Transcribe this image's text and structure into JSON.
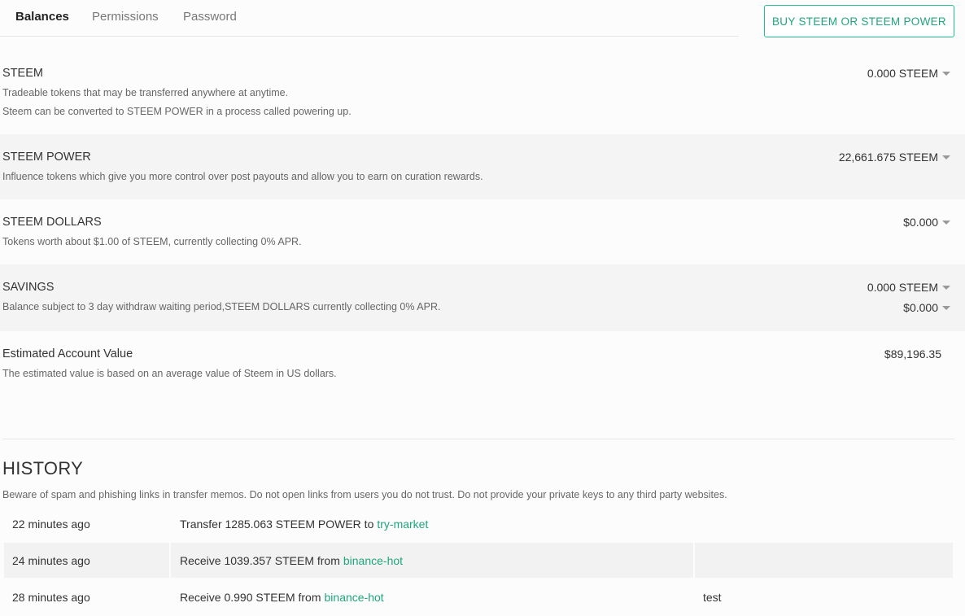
{
  "tabs": [
    {
      "label": "Balances",
      "active": true
    },
    {
      "label": "Permissions",
      "active": false
    },
    {
      "label": "Password",
      "active": false
    }
  ],
  "buy_button": "BUY STEEM OR STEEM POWER",
  "balances": {
    "steem": {
      "title": "STEEM",
      "desc1": "Tradeable tokens that may be transferred anywhere at anytime.",
      "desc2": "Steem can be converted to STEEM POWER in a process called powering up.",
      "amount": "0.000 STEEM"
    },
    "steem_power": {
      "title": "STEEM POWER",
      "desc1": "Influence tokens which give you more control over post payouts and allow you to earn on curation rewards.",
      "amount": "22,661.675 STEEM"
    },
    "steem_dollars": {
      "title": "STEEM DOLLARS",
      "desc1": "Tokens worth about $1.00 of STEEM, currently collecting 0% APR.",
      "amount": "$0.000"
    },
    "savings": {
      "title": "SAVINGS",
      "desc1": "Balance subject to 3 day withdraw waiting period,STEEM DOLLARS currently collecting 0% APR.",
      "amount_steem": "0.000 STEEM",
      "amount_sbd": "$0.000"
    },
    "estimated": {
      "title": "Estimated Account Value",
      "desc1": "The estimated value is based on an average value of Steem in US dollars.",
      "amount": "$89,196.35"
    }
  },
  "history": {
    "title": "HISTORY",
    "note": "Beware of spam and phishing links in transfer memos. Do not open links from users you do not trust. Do not provide your private keys to any third party websites.",
    "rows": [
      {
        "time": "22 minutes ago",
        "text": "Transfer 1285.063 STEEM POWER to",
        "link": "try-market",
        "memo": ""
      },
      {
        "time": "24 minutes ago",
        "text": "Receive 1039.357 STEEM from",
        "link": "binance-hot",
        "memo": ""
      },
      {
        "time": "28 minutes ago",
        "text": "Receive 0.990 STEEM from",
        "link": "binance-hot",
        "memo": "test"
      }
    ]
  },
  "colors": {
    "accent": "#1fa57c",
    "row_shade": "#f4f4f4"
  }
}
